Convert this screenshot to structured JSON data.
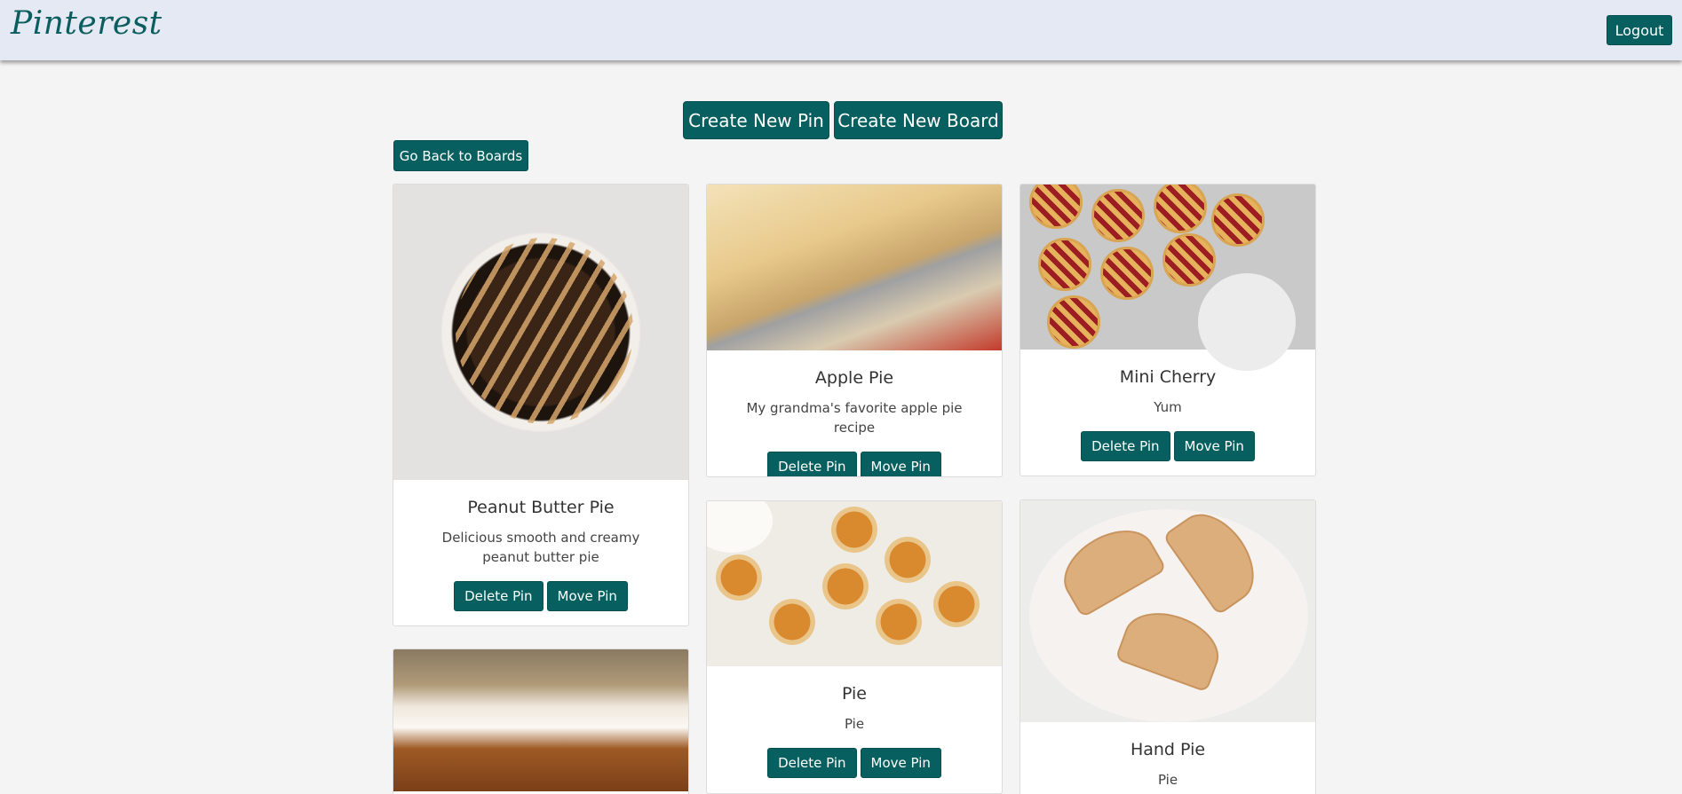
{
  "brand": "Pinterest",
  "nav": {
    "logout_label": "Logout"
  },
  "actions": {
    "create_pin": "Create New Pin",
    "create_board": "Create New Board",
    "back": "Go Back to Boards"
  },
  "pin_buttons": {
    "delete": "Delete Pin",
    "move": "Move Pin"
  },
  "pins": [
    {
      "title": "Peanut Butter Pie",
      "description": "Delicious smooth and creamy peanut butter pie"
    },
    {
      "title": "Apple Pie",
      "description": "My grandma's favorite apple pie recipe"
    },
    {
      "title": "Mini Cherry",
      "description": "Yum"
    },
    {
      "title": "Pie",
      "description": "Pie"
    },
    {
      "title": "Hand Pie",
      "description": "Pie"
    }
  ],
  "colors": {
    "accent": "#07605f",
    "navbar_bg": "#e4e9f3",
    "page_bg": "#f4f4f4"
  }
}
